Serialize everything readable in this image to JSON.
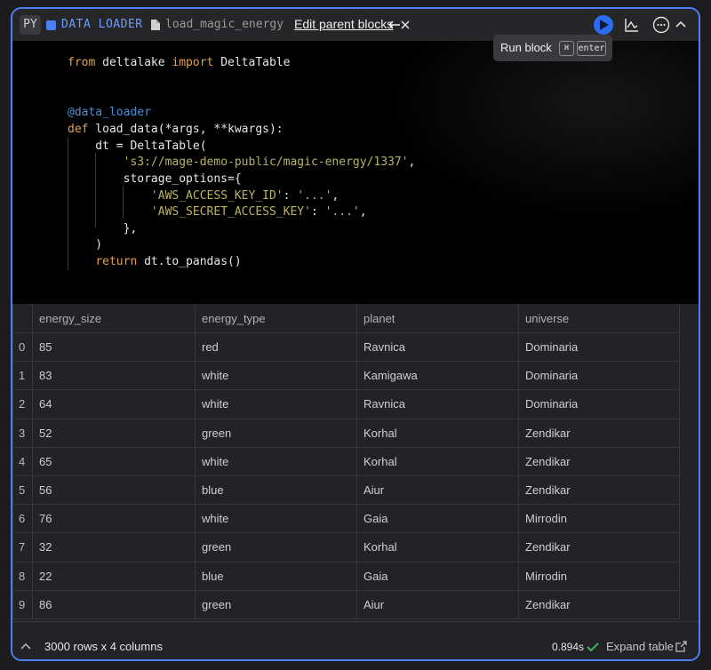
{
  "header": {
    "lang": "PY",
    "block_type": "DATA LOADER",
    "block_name": "load_magic_energy",
    "edit_parent": "Edit parent blocks",
    "colors": {
      "accent": "#4d7ef6",
      "run_button": "#2c6cf2"
    }
  },
  "tooltip": {
    "label": "Run block",
    "key1": "⌘",
    "key2": "enter"
  },
  "code": {
    "lines": [
      "from deltalake import DeltaTable",
      "",
      "",
      "@data_loader",
      "def load_data(*args, **kwargs):",
      "    dt = DeltaTable(",
      "        's3://mage-demo-public/magic-energy/1337',",
      "        storage_options={",
      "            'AWS_ACCESS_KEY_ID': '...',",
      "            'AWS_SECRET_ACCESS_KEY': '...',",
      "        },",
      "    )",
      "    return dt.to_pandas()"
    ]
  },
  "table": {
    "columns": [
      "energy_size",
      "energy_type",
      "planet",
      "universe"
    ],
    "rows": [
      [
        "0",
        "85",
        "red",
        "Ravnica",
        "Dominaria"
      ],
      [
        "1",
        "83",
        "white",
        "Kamigawa",
        "Dominaria"
      ],
      [
        "2",
        "64",
        "white",
        "Ravnica",
        "Dominaria"
      ],
      [
        "3",
        "52",
        "green",
        "Korhal",
        "Zendikar"
      ],
      [
        "4",
        "65",
        "white",
        "Korhal",
        "Zendikar"
      ],
      [
        "5",
        "56",
        "blue",
        "Aiur",
        "Zendikar"
      ],
      [
        "6",
        "76",
        "white",
        "Gaia",
        "Mirrodin"
      ],
      [
        "7",
        "32",
        "green",
        "Korhal",
        "Zendikar"
      ],
      [
        "8",
        "22",
        "blue",
        "Gaia",
        "Mirrodin"
      ],
      [
        "9",
        "86",
        "green",
        "Aiur",
        "Zendikar"
      ]
    ]
  },
  "footer": {
    "rows_info": "3000 rows x 4 columns",
    "exec_time": "0.894s",
    "expand_table": "Expand table"
  }
}
